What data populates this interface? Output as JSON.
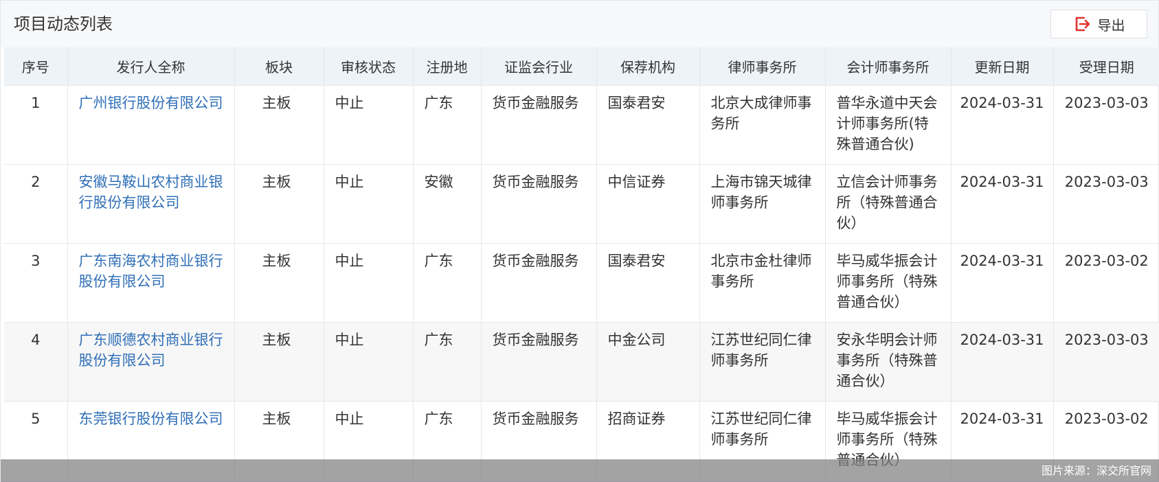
{
  "panel": {
    "title": "项目动态列表",
    "export_label": "导出",
    "export_icon": "export-icon",
    "accent_color": "#e0322d"
  },
  "table": {
    "headers": [
      "序号",
      "发行人全称",
      "板块",
      "审核状态",
      "注册地",
      "证监会行业",
      "保荐机构",
      "律师事务所",
      "会计师事务所",
      "更新日期",
      "受理日期"
    ],
    "rows": [
      {
        "no": "1",
        "name": "广州银行股份有限公司",
        "board": "主板",
        "status": "中止",
        "region": "广东",
        "industry": "货币金融服务",
        "sponsor": "国泰君安",
        "law_firm": "北京大成律师事务所",
        "accounting_firm": "普华永道中天会计师事务所(特殊普通合伙)",
        "updated": "2024-03-31",
        "accepted": "2023-03-03"
      },
      {
        "no": "2",
        "name": "安徽马鞍山农村商业银行股份有限公司",
        "board": "主板",
        "status": "中止",
        "region": "安徽",
        "industry": "货币金融服务",
        "sponsor": "中信证券",
        "law_firm": "上海市锦天城律师事务所",
        "accounting_firm": "立信会计师事务所（特殊普通合伙）",
        "updated": "2024-03-31",
        "accepted": "2023-03-03"
      },
      {
        "no": "3",
        "name": "广东南海农村商业银行股份有限公司",
        "board": "主板",
        "status": "中止",
        "region": "广东",
        "industry": "货币金融服务",
        "sponsor": "国泰君安",
        "law_firm": "北京市金杜律师事务所",
        "accounting_firm": "毕马威华振会计师事务所（特殊普通合伙）",
        "updated": "2024-03-31",
        "accepted": "2023-03-02"
      },
      {
        "no": "4",
        "name": "广东顺德农村商业银行股份有限公司",
        "board": "主板",
        "status": "中止",
        "region": "广东",
        "industry": "货币金融服务",
        "sponsor": "中金公司",
        "law_firm": "江苏世纪同仁律师事务所",
        "accounting_firm": "安永华明会计师事务所（特殊普通合伙）",
        "updated": "2024-03-31",
        "accepted": "2023-03-03"
      },
      {
        "no": "5",
        "name": "东莞银行股份有限公司",
        "board": "主板",
        "status": "中止",
        "region": "广东",
        "industry": "货币金融服务",
        "sponsor": "招商证券",
        "law_firm": "江苏世纪同仁律师事务所",
        "accounting_firm": "毕马威华振会计师事务所（特殊普通合伙）",
        "updated": "2024-03-31",
        "accepted": "2023-03-02"
      }
    ]
  },
  "caption": "图片来源：深交所官网"
}
